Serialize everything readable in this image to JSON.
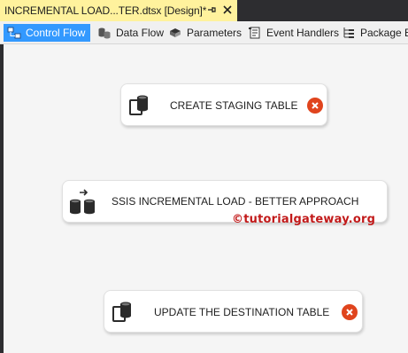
{
  "document_tab": {
    "title": "INCREMENTAL LOAD...TER.dtsx [Design]*",
    "pin_icon": "⊸",
    "close_icon": "✕"
  },
  "designer_tabs": [
    {
      "label": "Control Flow",
      "icon": "control-flow-icon",
      "active": true
    },
    {
      "label": "Data Flow",
      "icon": "data-flow-icon",
      "active": false
    },
    {
      "label": "Parameters",
      "icon": "parameters-icon",
      "active": false
    },
    {
      "label": "Event Handlers",
      "icon": "event-handlers-icon",
      "active": false
    },
    {
      "label": "Package Ex",
      "icon": "package-explorer-icon",
      "active": false
    }
  ],
  "tasks": [
    {
      "label": "CREATE STAGING TABLE",
      "icon": "execute-sql-task-icon",
      "status": "error"
    },
    {
      "label": "SSIS INCREMENTAL LOAD - BETTER APPROACH",
      "icon": "data-flow-task-icon",
      "status": "none"
    },
    {
      "label": "UPDATE THE DESTINATION TABLE",
      "icon": "execute-sql-task-icon",
      "status": "error"
    }
  ],
  "watermark": "©tutorialgateway.org",
  "colors": {
    "tab_highlight": "#fff29d",
    "active_tab": "#3399ff",
    "error": "#e0441d",
    "watermark": "#c21a1a"
  }
}
